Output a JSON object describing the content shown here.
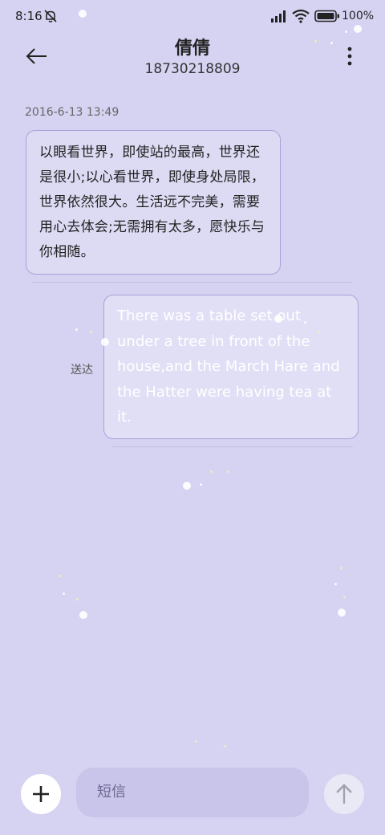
{
  "status_bar": {
    "time": "8:16",
    "battery": "100%",
    "icons": [
      "bell-muted-icon",
      "signal-icon",
      "wifi-icon",
      "battery-icon"
    ]
  },
  "header": {
    "contact_name": "倩倩",
    "contact_number": "18730218809",
    "back_icon": "arrow-left-icon",
    "more_icon": "more-vertical-icon"
  },
  "conversation": {
    "timestamp": "2016-6-13 13:49",
    "messages": [
      {
        "direction": "incoming",
        "text": "以眼看世界，即使站的最高，世界还是很小;以心看世界，即使身处局限，世界依然很大。生活远不完美，需要用心去体会;无需拥有太多，愿快乐与你相随。"
      },
      {
        "direction": "outgoing",
        "status": "送达",
        "text": "There was a table set out under a tree in front of the house,and the March Hare and the Hatter were having tea at it."
      }
    ]
  },
  "composer": {
    "placeholder": "短信",
    "add_icon": "plus-icon",
    "send_icon": "arrow-up-icon"
  },
  "colors": {
    "background": "#d6d3f2",
    "bubble_border": "#a7a2d8",
    "input_bg": "#c8c4ea"
  }
}
